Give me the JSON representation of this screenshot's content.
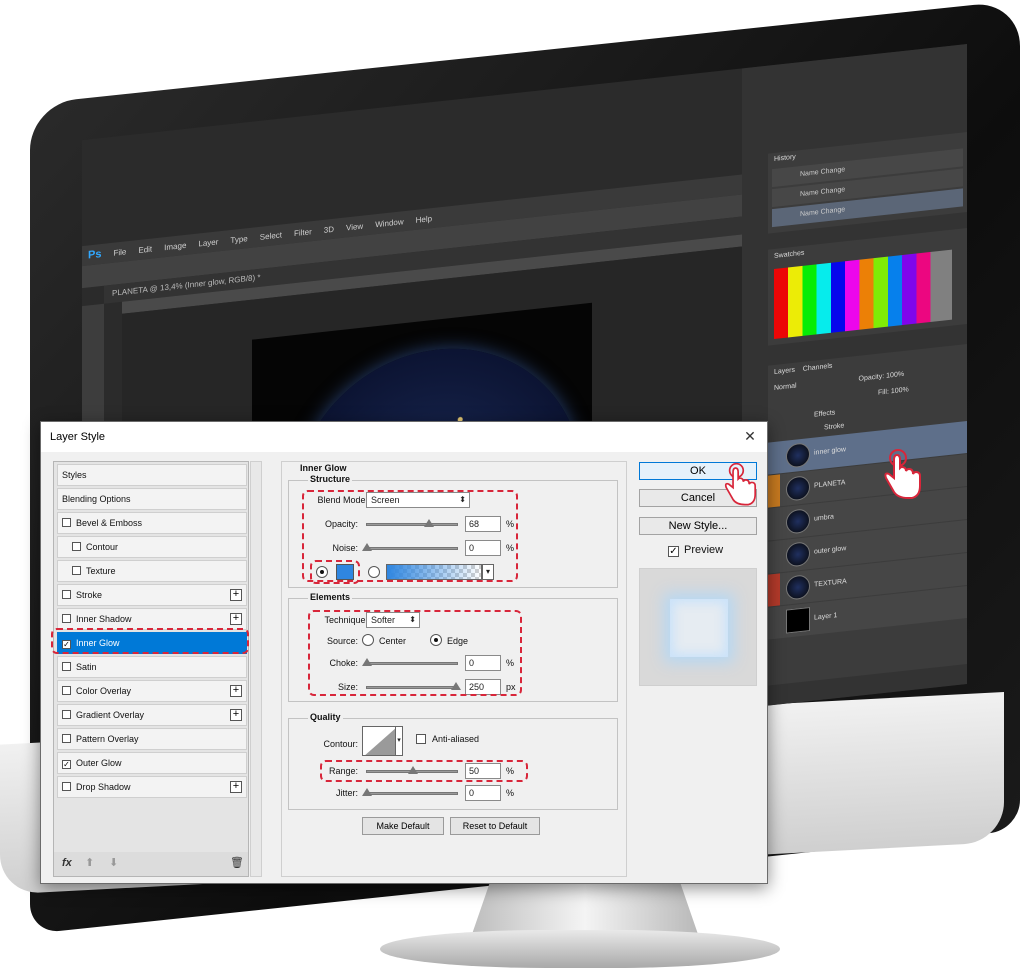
{
  "photoshop": {
    "logo": "Ps",
    "menu": [
      "File",
      "Edit",
      "Image",
      "Layer",
      "Type",
      "Select",
      "Filter",
      "3D",
      "View",
      "Window",
      "Help"
    ],
    "doc_tab": "PLANETA @ 13,4% (Inner glow, RGB/8) *",
    "history": {
      "title": "History",
      "rows": [
        "Name Change",
        "Name Change",
        "Name Change"
      ]
    },
    "swatches_tab": "Swatches",
    "layers": {
      "tabs": [
        "Layers",
        "Channels"
      ],
      "blend": "Normal",
      "opacity_label": "Opacity:",
      "opacity": "100%",
      "fill_label": "Fill:",
      "fill": "100%",
      "rows": [
        {
          "label": "Effects"
        },
        {
          "label": "Stroke"
        },
        {
          "label": "inner glow"
        },
        {
          "label": "PLANETA"
        },
        {
          "label": "umbra"
        },
        {
          "label": "outer glow"
        },
        {
          "label": "TEXTURA"
        },
        {
          "label": "Layer 1"
        }
      ]
    }
  },
  "dialog": {
    "title": "Layer Style",
    "style_list": [
      {
        "label": "Styles"
      },
      {
        "label": "Blending Options"
      },
      {
        "label": "Bevel & Emboss",
        "check": ""
      },
      {
        "label": "Contour",
        "check": ""
      },
      {
        "label": "Texture",
        "check": ""
      },
      {
        "label": "Stroke",
        "check": ""
      },
      {
        "label": "Inner Shadow",
        "check": ""
      },
      {
        "label": "Inner Glow",
        "check": "✓"
      },
      {
        "label": "Satin",
        "check": ""
      },
      {
        "label": "Color Overlay",
        "check": ""
      },
      {
        "label": "Gradient Overlay",
        "check": ""
      },
      {
        "label": "Pattern Overlay",
        "check": ""
      },
      {
        "label": "Outer Glow",
        "check": "✓"
      },
      {
        "label": "Drop Shadow",
        "check": ""
      }
    ],
    "footer": {
      "fx": "fx",
      "up": "⬆",
      "down": "⬇",
      "trash": "🗑"
    },
    "panel_title": "Inner Glow",
    "structure": {
      "title": "Structure",
      "blend_mode_label": "Blend Mode:",
      "blend_mode": "Screen",
      "opacity_label": "Opacity:",
      "opacity": 68,
      "noise_label": "Noise:",
      "noise": 0,
      "unit": "%",
      "glow_color": "#2f86e0"
    },
    "elements": {
      "title": "Elements",
      "technique_label": "Technique:",
      "technique": "Softer",
      "source_label": "Source:",
      "source_center": "Center",
      "source_edge": "Edge",
      "choke_label": "Choke:",
      "choke": 0,
      "choke_unit": "%",
      "size_label": "Size:",
      "size": 250,
      "size_unit": "px"
    },
    "quality": {
      "title": "Quality",
      "contour_label": "Contour:",
      "anti_aliased": "Anti-aliased",
      "range_label": "Range:",
      "range": 50,
      "range_unit": "%",
      "jitter_label": "Jitter:",
      "jitter": 0,
      "jitter_unit": "%"
    },
    "make_default": "Make Default",
    "reset_default": "Reset to Default",
    "ok": "OK",
    "cancel": "Cancel",
    "new_style": "New Style...",
    "preview": "Preview",
    "preview_check": "✓"
  },
  "colors": {
    "highlight": "#0079d7",
    "annotation": "#d8263a",
    "glow": "#2f86e0"
  }
}
